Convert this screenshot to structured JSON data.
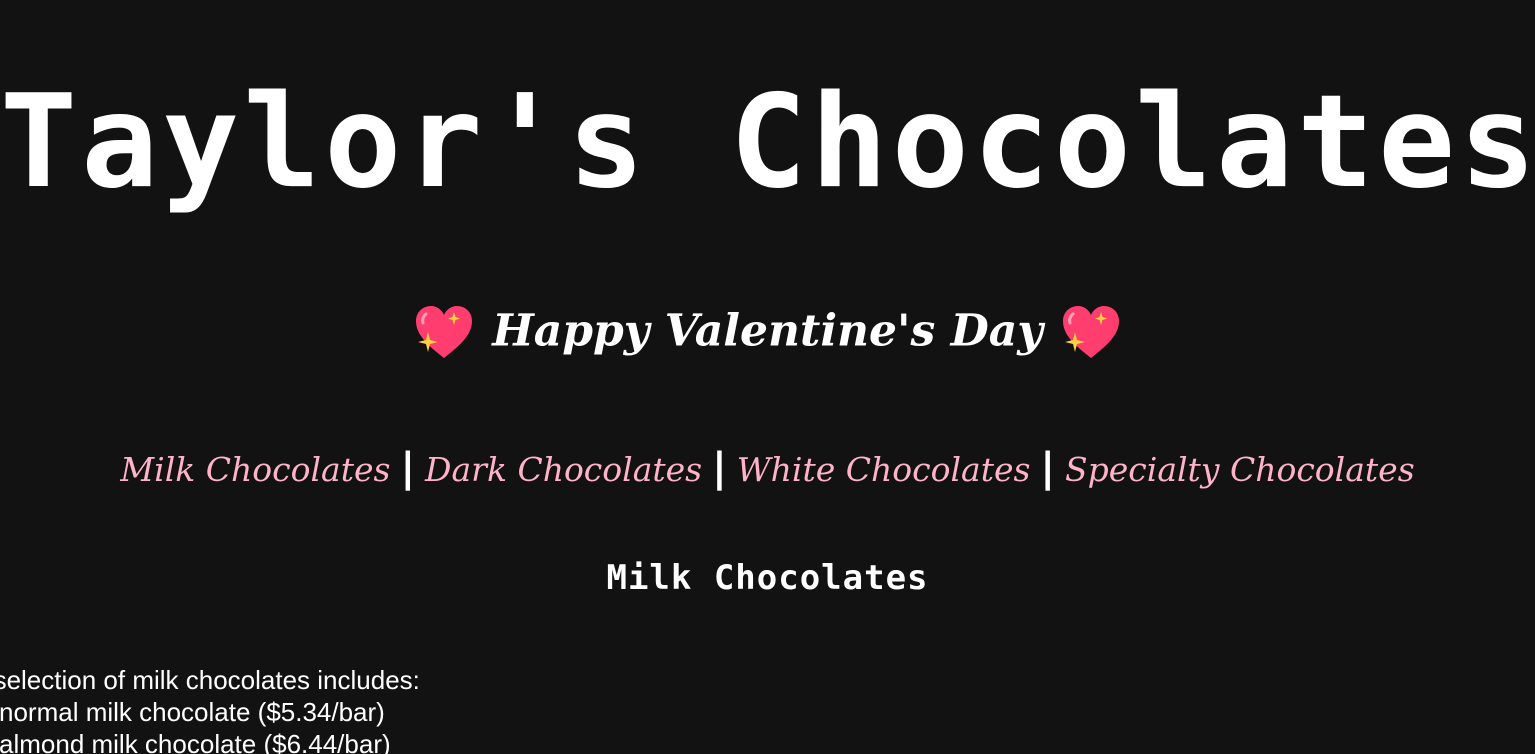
{
  "header": {
    "title": "Taylor's Chocolates",
    "greeting": "Happy Valentine's Day",
    "greeting_icon": "sparkling-heart-icon"
  },
  "nav": {
    "items": [
      {
        "label": "Milk Chocolates"
      },
      {
        "label": "Dark Chocolates"
      },
      {
        "label": "White Chocolates"
      },
      {
        "label": "Specialty Chocolates"
      }
    ],
    "separator": "|"
  },
  "section": {
    "heading": "Milk Chocolates",
    "intro": "Our selection of milk chocolates includes:",
    "items": [
      "normal milk chocolate ($5.34/bar)",
      "almond milk chocolate ($6.44/bar)"
    ]
  },
  "colors": {
    "background": "#121212",
    "nav_link": "#ffb3c9",
    "heart": "#ff3d6e",
    "sparkle": "#ffd23f",
    "text": "#ffffff"
  }
}
